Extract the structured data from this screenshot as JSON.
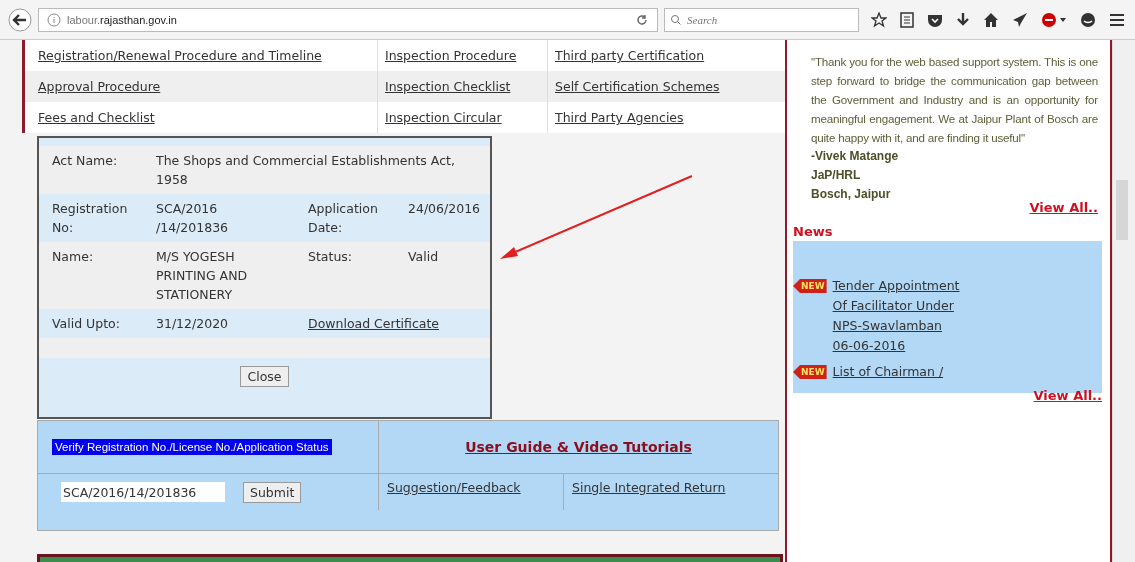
{
  "browser": {
    "url": "labour.**rajasthan.gov.in**",
    "search_placeholder": "Search"
  },
  "links": [
    [
      "Registration/Renewal Procedure and Timeline",
      "Inspection Procedure",
      "Third party Certification"
    ],
    [
      "Approval Procedure",
      "Inspection Checklist",
      "Self Certification Schemes"
    ],
    [
      "Fees and Checklist",
      "Inspection Circular",
      "Third Party Agencies"
    ]
  ],
  "popup": {
    "rows": [
      {
        "label": "Act Name:",
        "value": "The Shops and Commercial Establishments Act, 1958"
      },
      {
        "label": "Registration No:",
        "value": "SCA/2016 /14/201836",
        "label2": "Application Date:",
        "value2": "24/06/2016"
      },
      {
        "label": "Name:",
        "value": "M/S YOGESH PRINTING AND STATIONERY",
        "label2": "Status:",
        "value2": "Valid"
      },
      {
        "label": "Valid Upto:",
        "value": "31/12/2020",
        "link": "Download Certificate"
      }
    ],
    "close": "Close"
  },
  "verify": {
    "heading": "Verify Registration No./License No./Application Status",
    "value": "SCA/2016/14/201836",
    "submit": "Submit"
  },
  "user_guide": "User Guide & Video Tutorials",
  "bottom_links": [
    "Suggestion/Feedback",
    "Single Integrated Return"
  ],
  "testimonial": {
    "quote": "\"Thank you for the web based support system. This is one step forward to bridge the communication gap between  the Government and Industry and is an opportunity for meaningful engagement. We at Jaipur Plant of Bosch are quite happy with it, and are finding it useful\"",
    "author": [
      "-Vivek Matange",
      "JaP/HRL",
      "Bosch, Jaipur"
    ],
    "view_all": "View All.."
  },
  "news": {
    "title": "News",
    "items": [
      {
        "badge": "NEW",
        "text": "Tender Appointment Of Facilitator Under NPS-Swavlamban 06-06-2016"
      },
      {
        "badge": "NEW",
        "text": "List of Chairman /"
      }
    ],
    "view_all": "View All.."
  }
}
